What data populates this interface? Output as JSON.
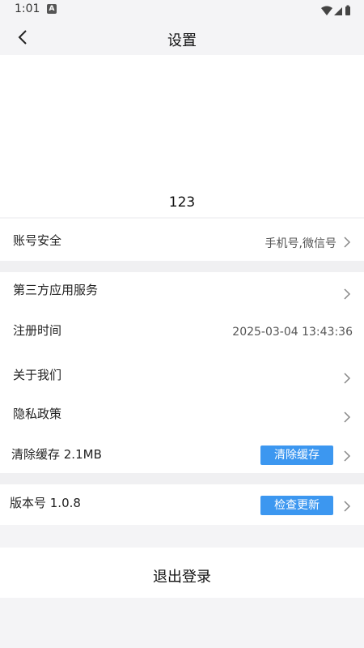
{
  "status_bar": {
    "time": "1:01",
    "indicator": "A"
  },
  "header": {
    "title": "设置"
  },
  "profile": {
    "username": "123"
  },
  "rows": {
    "account_security": {
      "label": "账号安全",
      "value": "手机号,微信号"
    },
    "third_party": {
      "label": "第三方应用服务"
    },
    "register_time": {
      "label": "注册时间",
      "value": "2025-03-04 13:43:36"
    },
    "about_us": {
      "label": "关于我们"
    },
    "privacy": {
      "label": "隐私政策"
    },
    "clear_cache": {
      "label": "清除缓存 2.1MB",
      "button": "清除缓存"
    },
    "version": {
      "label": "版本号 1.0.8",
      "button": "检查更新"
    }
  },
  "logout": {
    "label": "退出登录"
  },
  "icons": {
    "back": "chevron-left-icon",
    "chevron": "chevron-right-icon",
    "wifi": "wifi-icon",
    "signal": "signal-icon",
    "battery": "battery-icon"
  },
  "colors": {
    "accent": "#3c97f0",
    "background": "#f4f4f6"
  }
}
